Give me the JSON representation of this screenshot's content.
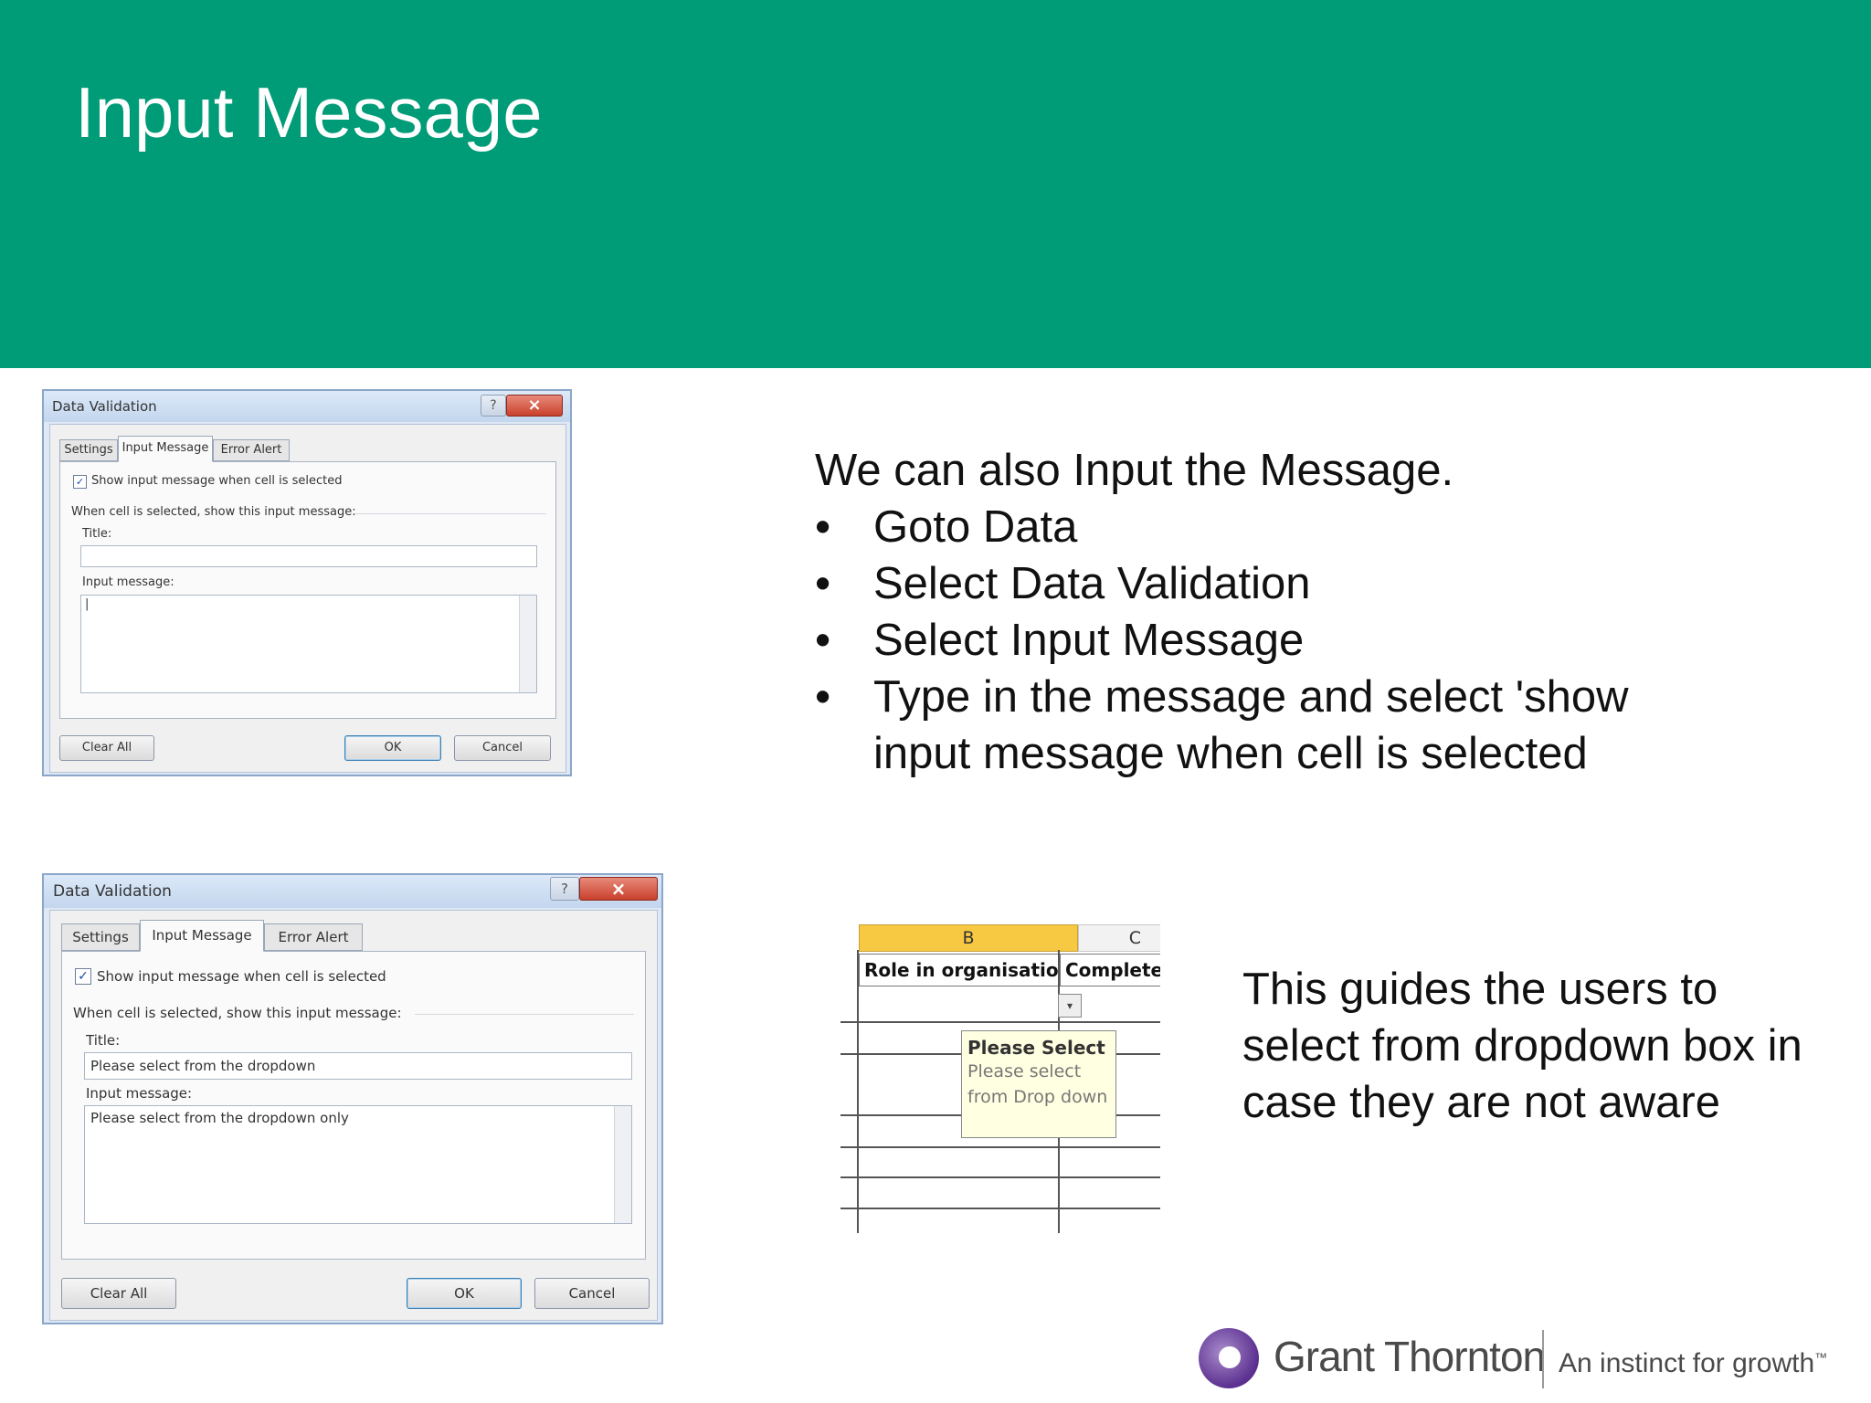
{
  "slide": {
    "title": "Input Message",
    "header_color": "#009b77"
  },
  "dialog_top": {
    "window_title": "Data Validation",
    "help_glyph": "?",
    "close_glyph": "×",
    "tabs": [
      {
        "label": "Settings"
      },
      {
        "label": "Input Message"
      },
      {
        "label": "Error Alert"
      }
    ],
    "checkbox_label": "Show input message when cell is selected",
    "section_label": "When cell is selected, show this input message:",
    "title_label": "Title:",
    "title_value": "",
    "message_label": "Input message:",
    "message_value": "|",
    "clear_all": "Clear All",
    "ok": "OK",
    "cancel": "Cancel"
  },
  "dialog_bottom": {
    "window_title": "Data Validation",
    "help_glyph": "?",
    "close_glyph": "×",
    "tabs": [
      {
        "label": "Settings"
      },
      {
        "label": "Input Message"
      },
      {
        "label": "Error Alert"
      }
    ],
    "checkbox_label": "Show input message when cell is selected",
    "section_label": "When cell is selected, show this input message:",
    "title_label": "Title:",
    "title_value": "Please select from the dropdown",
    "message_label": "Input message:",
    "message_value": "Please select from the dropdown only",
    "clear_all": "Clear All",
    "ok": "OK",
    "cancel": "Cancel"
  },
  "instructions": {
    "intro": "We can also Input the Message.",
    "bullet_glyph": "•",
    "bullets": [
      "Goto Data",
      "Select Data Validation",
      "Select Input Message",
      "Type in the message and select 'show input message when cell is selected"
    ]
  },
  "excel": {
    "col_b": "B",
    "col_c": "C",
    "header_b": "Role in organisation",
    "header_c": "Complete",
    "dropdown_glyph": "▾",
    "tooltip_title": "Please Select",
    "tooltip_line1": "Please select",
    "tooltip_line2": "from Drop down"
  },
  "side_note": "This guides the users to select from dropdown box in case they are not aware",
  "logo": {
    "name": "Grant Thornton",
    "tagline": "An instinct for growth",
    "tm": "™"
  }
}
